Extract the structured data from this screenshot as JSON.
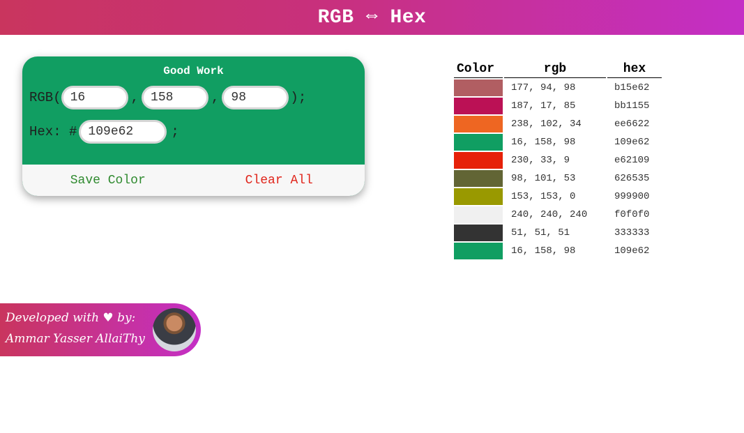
{
  "header": {
    "title": "RGB ⇔ Hex"
  },
  "converter": {
    "status": "Good Work",
    "rgb_prefix": "RGB(",
    "comma": ",",
    "rgb_suffix": ");",
    "r": "16",
    "g": "158",
    "b": "98",
    "hex_label": "Hex: #",
    "hex_value": "109e62",
    "hex_suffix": ";",
    "background": "#119e62",
    "save_label": "Save Color",
    "clear_label": "Clear All"
  },
  "saved_colors": {
    "headers": {
      "color": "Color",
      "rgb": "rgb",
      "hex": "hex"
    },
    "rows": [
      {
        "swatch": "#b15e62",
        "rgb": "177, 94, 98",
        "hex": "b15e62"
      },
      {
        "swatch": "#bb1155",
        "rgb": "187, 17, 85",
        "hex": "bb1155"
      },
      {
        "swatch": "#ee6622",
        "rgb": "238, 102, 34",
        "hex": "ee6622"
      },
      {
        "swatch": "#109e62",
        "rgb": "16, 158, 98",
        "hex": "109e62"
      },
      {
        "swatch": "#e62109",
        "rgb": "230, 33, 9",
        "hex": "e62109"
      },
      {
        "swatch": "#626535",
        "rgb": "98, 101, 53",
        "hex": "626535"
      },
      {
        "swatch": "#999900",
        "rgb": "153, 153, 0",
        "hex": "999900"
      },
      {
        "swatch": "#f0f0f0",
        "rgb": "240, 240, 240",
        "hex": "f0f0f0"
      },
      {
        "swatch": "#333333",
        "rgb": "51, 51, 51",
        "hex": "333333"
      },
      {
        "swatch": "#109e62",
        "rgb": "16, 158, 98",
        "hex": "109e62"
      }
    ]
  },
  "footer": {
    "line1": "Developed with ♥ by:",
    "line2": "Ammar Yasser AllaiThy",
    "avatar_icon": "developer-avatar"
  }
}
